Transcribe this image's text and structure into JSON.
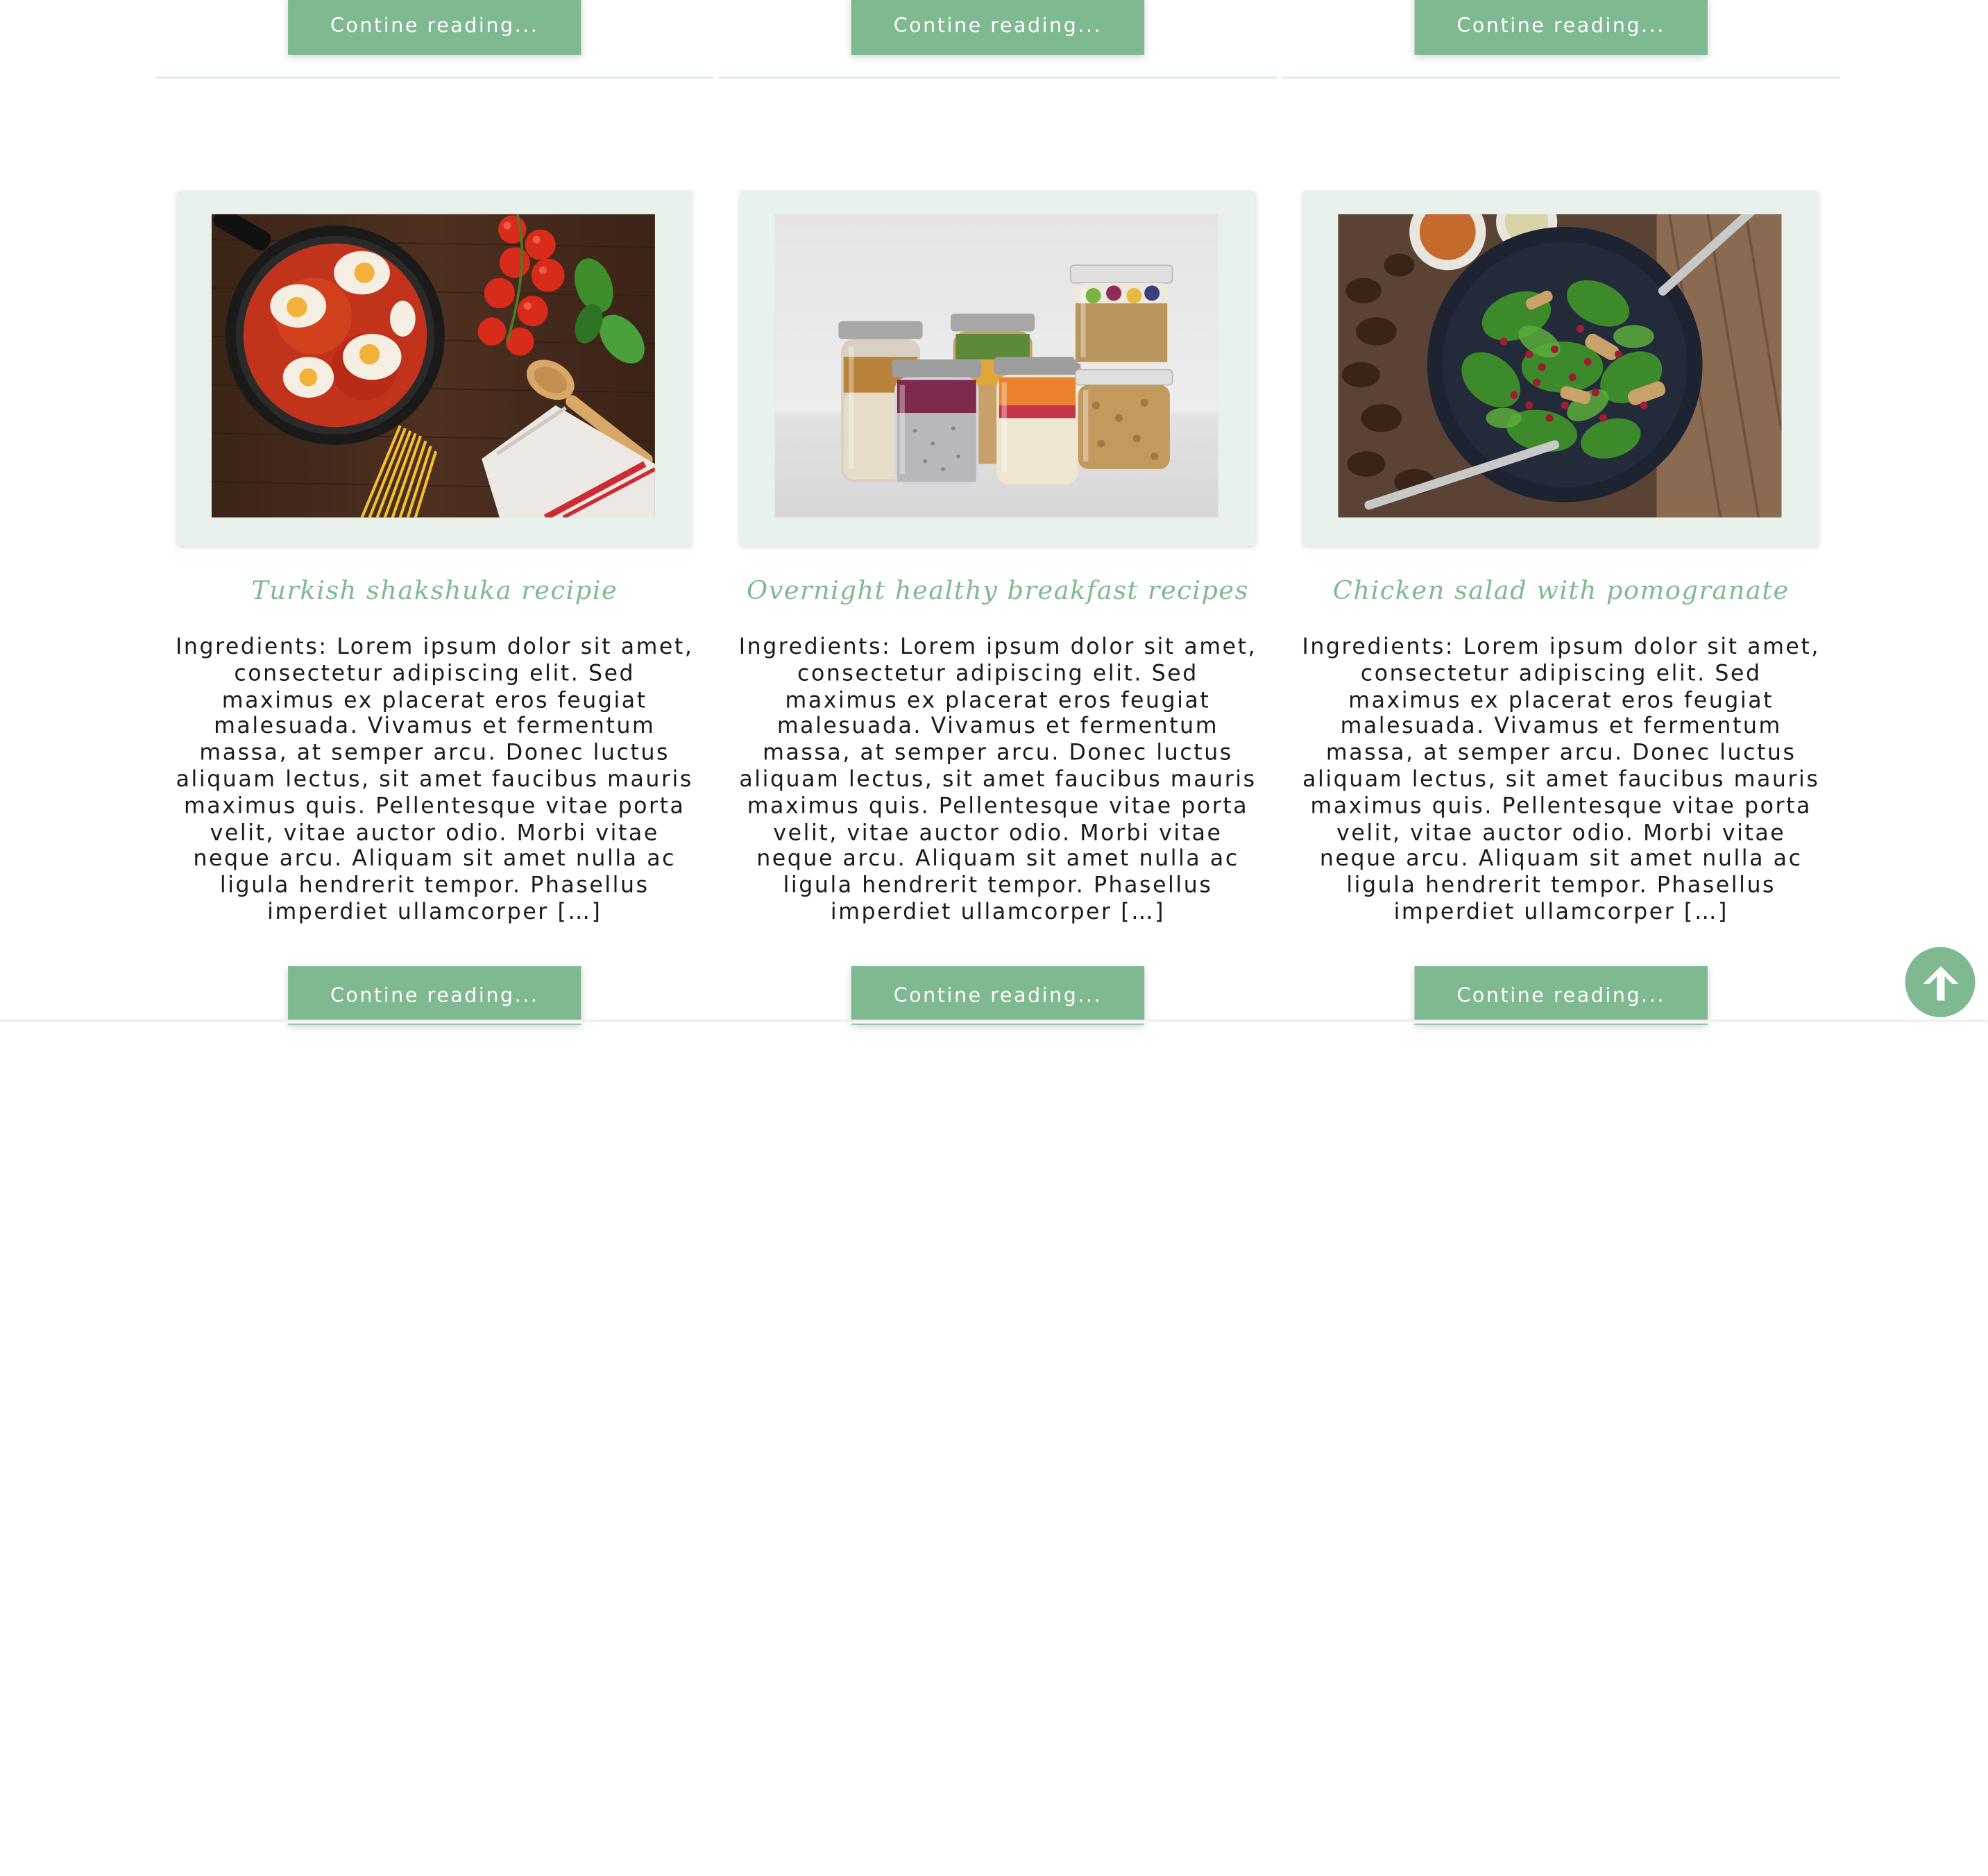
{
  "top_row": {
    "buttons": [
      {
        "label": "Contine reading..."
      },
      {
        "label": "Contine reading..."
      },
      {
        "label": "Contine reading..."
      }
    ]
  },
  "posts": [
    {
      "title": "Turkish shakshuka recipie",
      "excerpt": "Ingredients: Lorem ipsum dolor sit amet, consectetur adipiscing elit. Sed maximus ex placerat eros feugiat malesuada. Vivamus et fermentum massa, at semper arcu. Donec luctus aliquam lectus, sit amet faucibus mauris maximus quis. Pellentesque vitae porta velit, vitae auctor odio. Morbi vitae neque arcu. Aliquam sit amet nulla ac ligula hendrerit tempor. Phasellus imperdiet ullamcorper […]",
      "button_label": "Contine reading..."
    },
    {
      "title": "Overnight healthy breakfast recipes",
      "excerpt": "Ingredients: Lorem ipsum dolor sit amet, consectetur adipiscing elit. Sed maximus ex placerat eros feugiat malesuada. Vivamus et fermentum massa, at semper arcu. Donec luctus aliquam lectus, sit amet faucibus mauris maximus quis. Pellentesque vitae porta velit, vitae auctor odio. Morbi vitae neque arcu. Aliquam sit amet nulla ac ligula hendrerit tempor. Phasellus imperdiet ullamcorper […]",
      "button_label": "Contine reading..."
    },
    {
      "title": "Chicken salad with pomogranate",
      "excerpt": "Ingredients: Lorem ipsum dolor sit amet, consectetur adipiscing elit. Sed maximus ex placerat eros feugiat malesuada. Vivamus et fermentum massa, at semper arcu. Donec luctus aliquam lectus, sit amet faucibus mauris maximus quis. Pellentesque vitae porta velit, vitae auctor odio. Morbi vitae neque arcu. Aliquam sit amet nulla ac ligula hendrerit tempor. Phasellus imperdiet ullamcorper […]",
      "button_label": "Contine reading..."
    }
  ],
  "scroll_top": {
    "icon": "arrow-up-icon"
  },
  "colors": {
    "accent": "#7fb992",
    "card_frame": "#e8f1ec",
    "divider": "#e6efe9",
    "text": "#1a1a1a"
  }
}
